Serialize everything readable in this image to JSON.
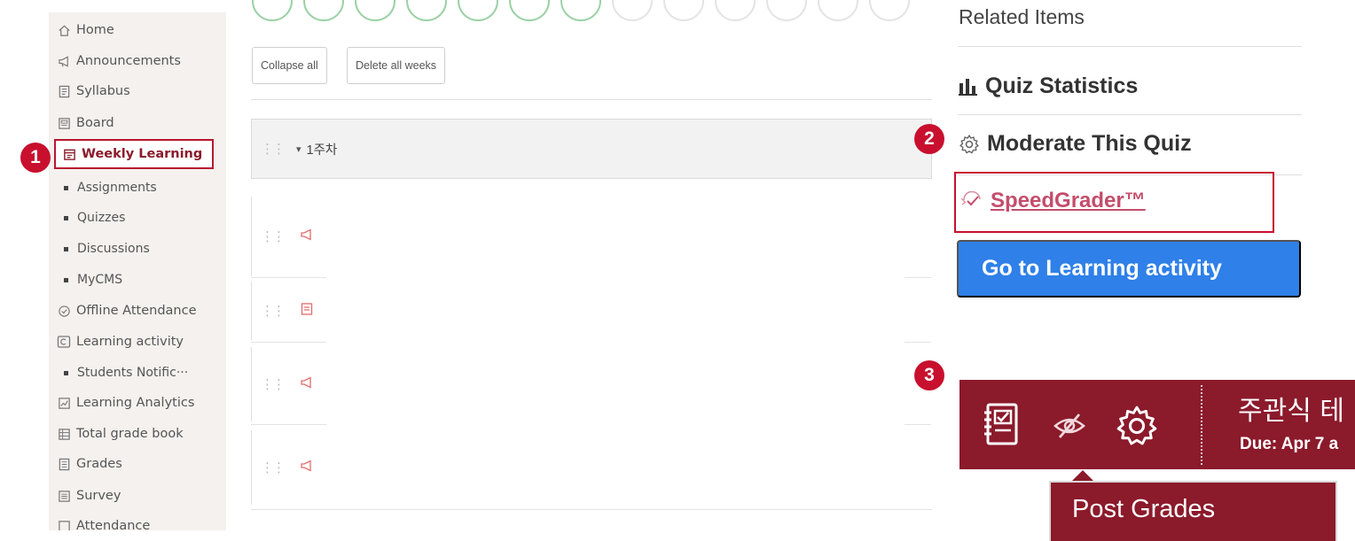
{
  "sidebar": {
    "items": [
      {
        "label": "Home",
        "icon": "home-icon"
      },
      {
        "label": "Announcements",
        "icon": "megaphone-icon"
      },
      {
        "label": "Syllabus",
        "icon": "document-icon"
      },
      {
        "label": "Board",
        "icon": "board-icon"
      },
      {
        "label": "Weekly Learning",
        "icon": "calendar-icon",
        "active": true
      },
      {
        "label": "Assignments",
        "sub": true
      },
      {
        "label": "Quizzes",
        "sub": true
      },
      {
        "label": "Discussions",
        "sub": true
      },
      {
        "label": "MyCMS",
        "sub": true
      },
      {
        "label": "Offline Attendance",
        "icon": "check-circle-icon"
      },
      {
        "label": "Learning activity",
        "icon": "activity-icon"
      },
      {
        "label": "Students Notific···",
        "sub": true
      },
      {
        "label": "Learning Analytics",
        "icon": "analytics-icon"
      },
      {
        "label": "Total grade book",
        "icon": "gradebook-icon"
      },
      {
        "label": "Grades",
        "icon": "grades-icon"
      },
      {
        "label": "Survey",
        "icon": "survey-icon"
      },
      {
        "label": "Attendance",
        "icon": "attendance-icon"
      }
    ]
  },
  "badges": {
    "one": "1",
    "two": "2",
    "three": "3"
  },
  "modules": {
    "collapse_label": "Collapse all",
    "delete_label": "Delete all weeks",
    "week_title": "1주차",
    "week_caret": "▾"
  },
  "related": {
    "title": "Related Items",
    "quiz_statistics": "Quiz Statistics",
    "moderate": "Moderate This Quiz",
    "speedgrader": "SpeedGrader™",
    "go_button": "Go to Learning activity"
  },
  "toolbar": {
    "title": "주관식 테",
    "due": "Due: Apr 7 a"
  },
  "tooltip": {
    "text": "Post Grades"
  },
  "colors": {
    "brand": "#8b1a2b",
    "badge": "#c8102e",
    "primary_button": "#2f80e8",
    "speedgrader_link": "#c44d6b"
  }
}
